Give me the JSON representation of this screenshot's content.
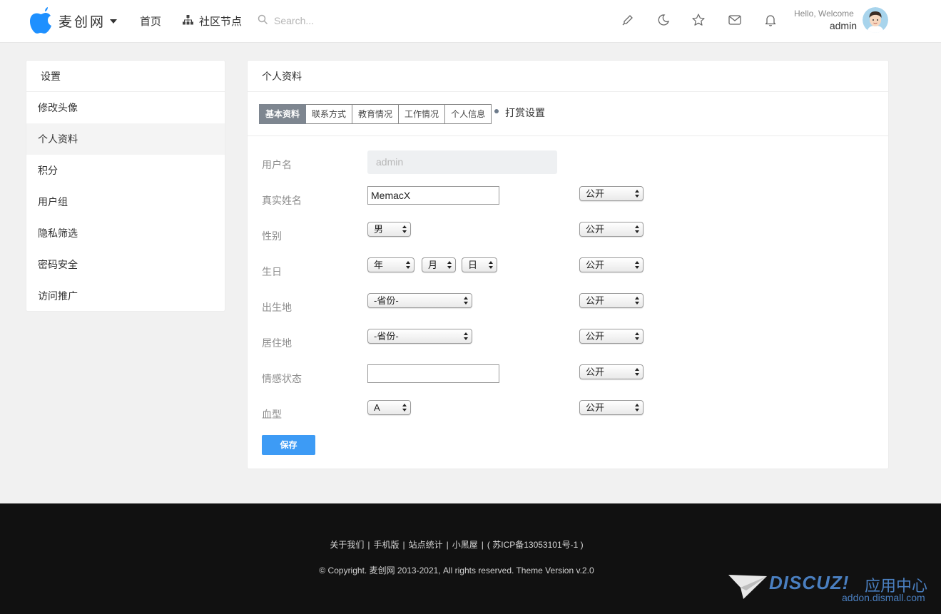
{
  "header": {
    "brand": "麦创网",
    "nav": {
      "home": "首页",
      "nodes": "社区节点"
    },
    "search": {
      "placeholder": "Search..."
    },
    "icons": [
      "pen-icon",
      "moon-icon",
      "star-icon",
      "mail-icon",
      "bell-icon"
    ],
    "greeting": "Hello, Welcome",
    "username": "admin"
  },
  "sidebar": {
    "title": "设置",
    "items": [
      {
        "label": "修改头像"
      },
      {
        "label": "个人资料",
        "active": true
      },
      {
        "label": "积分"
      },
      {
        "label": "用户组"
      },
      {
        "label": "隐私筛选"
      },
      {
        "label": "密码安全"
      },
      {
        "label": "访问推广"
      }
    ]
  },
  "main": {
    "title": "个人资料",
    "tabs": [
      {
        "label": "基本资料",
        "active": true
      },
      {
        "label": "联系方式"
      },
      {
        "label": "教育情况"
      },
      {
        "label": "工作情况"
      },
      {
        "label": "个人信息"
      }
    ],
    "extra_tab": "打赏设置",
    "fields": {
      "username": {
        "label": "用户名",
        "value": "admin"
      },
      "realname": {
        "label": "真实姓名",
        "value": "MemacX",
        "privacy": "公开"
      },
      "gender": {
        "label": "性别",
        "value": "男",
        "privacy": "公开"
      },
      "birthday": {
        "label": "生日",
        "year": "年",
        "month": "月",
        "day": "日",
        "privacy": "公开"
      },
      "birthplace": {
        "label": "出生地",
        "value": "-省份-",
        "privacy": "公开"
      },
      "residence": {
        "label": "居住地",
        "value": "-省份-",
        "privacy": "公开"
      },
      "affective": {
        "label": "情感状态",
        "value": "",
        "privacy": "公开"
      },
      "bloodtype": {
        "label": "血型",
        "value": "A",
        "privacy": "公开"
      }
    },
    "save_label": "保存"
  },
  "footer": {
    "links": [
      "关于我们",
      "手机版",
      "站点统计",
      "小黑屋",
      "( 苏ICP备13053101号-1 )"
    ],
    "copyright": "© Copyright. 麦创网 2013-2021, All rights reserved. Theme Version v.2.0",
    "watermark": {
      "brand": "DISCUZ!",
      "cn": "应用中心",
      "url": "addon.dismall.com"
    }
  },
  "colors": {
    "accent": "#3d9bf5",
    "footer_bg": "#111111",
    "tab_active": "#7e8690"
  }
}
